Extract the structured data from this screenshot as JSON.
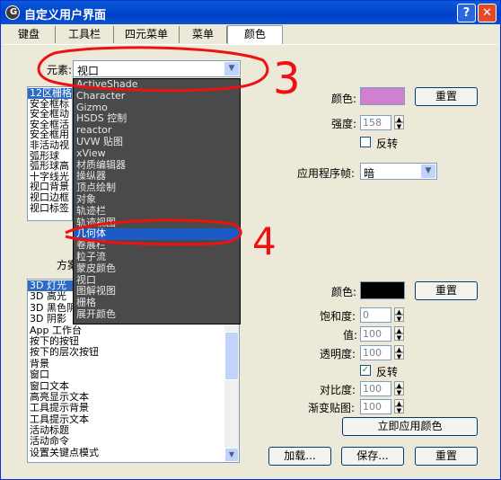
{
  "window": {
    "title": "自定义用户界面",
    "help": "?",
    "close": "✕"
  },
  "tabs": [
    "键盘",
    "工具栏",
    "四元菜单",
    "菜单",
    "颜色"
  ],
  "element": {
    "label": "元素:",
    "value": "视口"
  },
  "upper_list": [
    "12区栅格",
    "安全框标",
    "安全框动",
    "安全框活",
    "安全框用",
    "非活动视",
    "弧形球",
    "弧形球高",
    "十字线光",
    "视口背景",
    "视口边框",
    "视口标签"
  ],
  "dropdown": {
    "items": [
      "ActiveShade",
      "Character",
      "Gizmo",
      "HSDS 控制",
      "reactor",
      "UVW 贴图",
      "xView",
      "材质编辑器",
      "操纵器",
      "顶点绘制",
      "对象",
      "轨迹栏",
      "轨迹视图",
      "几何体",
      "卷展栏",
      "粒子流",
      "蒙皮颜色",
      "视口",
      "图解视图",
      "栅格",
      "展开颜色"
    ],
    "highlighted_index": 13
  },
  "scheme_label": "方案",
  "lower_list": [
    "3D 灯光",
    "3D 高光",
    "3D 黑色阴",
    "3D 阴影",
    "App 工作台",
    "按下的按钮",
    "按下的层次按钮",
    "背景",
    "窗口",
    "窗口文本",
    "高亮显示文本",
    "工具提示背景",
    "工具提示文本",
    "活动标题",
    "活动命令",
    "设置关键点模式"
  ],
  "upper_right": {
    "color_label": "颜色:",
    "color_value": "#d080d0",
    "reset": "重置",
    "intensity_label": "强度:",
    "intensity_value": "158",
    "invert": "反转",
    "invert_checked": false,
    "app_frame_label": "应用程序帧:",
    "app_frame_value": "暗"
  },
  "lower_right": {
    "color_label": "颜色:",
    "color_value": "#000000",
    "reset": "重置",
    "saturation_label": "饱和度:",
    "saturation_value": "0",
    "value_label": "值:",
    "value_value": "100",
    "transparency_label": "透明度:",
    "transparency_value": "100",
    "invert": "反转",
    "invert_checked": true,
    "contrast_label": "对比度:",
    "contrast_value": "100",
    "gradient_label": "渐变贴图:",
    "gradient_value": "100",
    "apply_now": "立即应用颜色"
  },
  "bottom": {
    "load": "加载...",
    "save": "保存...",
    "reset": "重置"
  },
  "annotations": {
    "n3": "3",
    "n4": "4",
    "annotation_color": "#ee1111"
  },
  "check_mark": "✓",
  "arrow_up": "▲",
  "arrow_down": "▼",
  "spin_up": "▲",
  "spin_down": "▼"
}
